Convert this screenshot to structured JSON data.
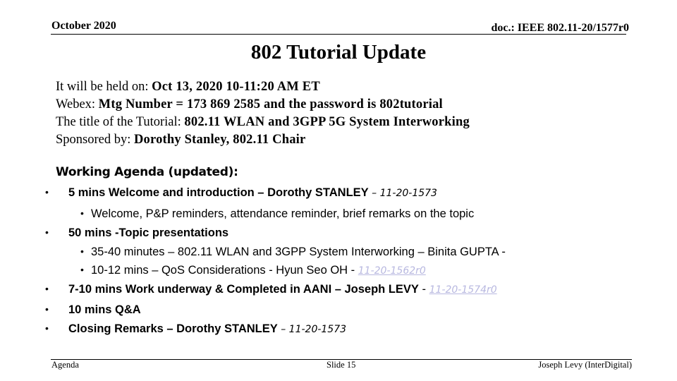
{
  "header": {
    "date": "October 2020",
    "doc": "doc.: IEEE 802.11-20/1577r0"
  },
  "title": "802 Tutorial Update",
  "info": [
    {
      "label": "It will be held on: ",
      "value": "Oct 13, 2020 10-11:20 AM ET"
    },
    {
      "label": "Webex: ",
      "value": "Mtg Number = 173 869 2585 and the password is  802tutorial"
    },
    {
      "label": "The title of the Tutorial: ",
      "value": "802.11 WLAN and 3GPP 5G System Interworking"
    },
    {
      "label": "Sponsored by: ",
      "value": "Dorothy Stanley, 802.11 Chair"
    }
  ],
  "agenda": {
    "heading": "Working Agenda (updated):",
    "bullet": "•",
    "items": [
      {
        "text": "5 mins Welcome and introduction – Dorothy STANLEY",
        "sep": " – ",
        "ref": "11-20-1573"
      },
      {
        "text": "Welcome, P&P reminders, attendance reminder, brief remarks on the topic"
      },
      {
        "text": "50 mins -Topic presentations"
      },
      {
        "text": "35-40 minutes – 802.11 WLAN and 3GPP System Interworking – Binita GUPTA -"
      },
      {
        "text": "10-12 mins – QoS Considerations - Hyun Seo OH",
        "sep": " - ",
        "ref": "11-20-1562r0"
      },
      {
        "text": "7-10 mins Work underway & Completed in AANI – Joseph LEVY",
        "sep": " - ",
        "ref": "11-20-1574r0"
      },
      {
        "text": "10 mins Q&A"
      },
      {
        "text": "Closing Remarks – Dorothy STANLEY",
        "sep": " – ",
        "ref": "11-20-1573"
      }
    ]
  },
  "footer": {
    "left": "Agenda",
    "center": "Slide 15",
    "right": "Joseph Levy (InterDigital)"
  },
  "colors": {
    "link": "#b8b8e0",
    "text": "#000000"
  }
}
